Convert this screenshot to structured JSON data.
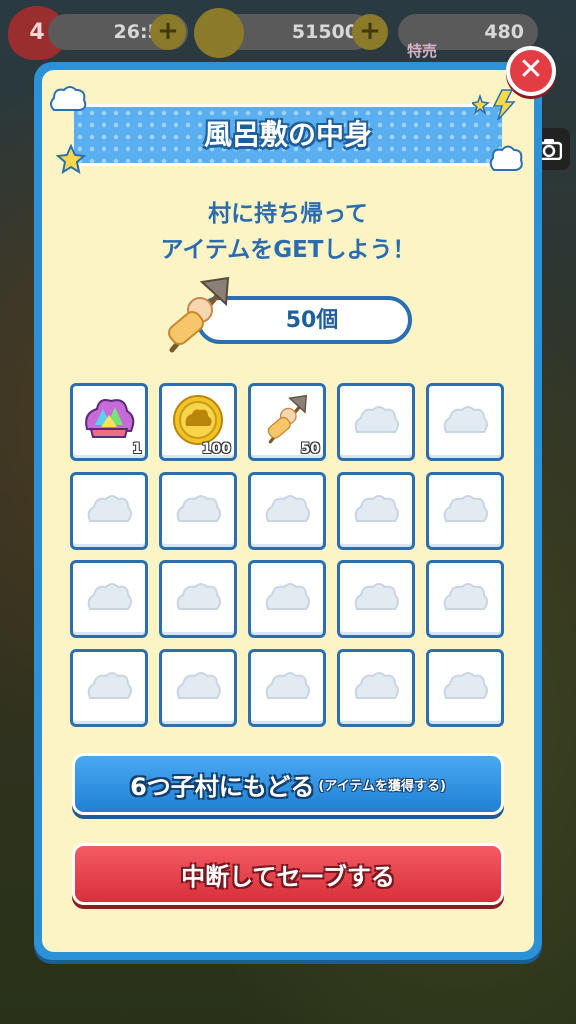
{
  "topbar": {
    "lives": "4",
    "timer": "26:59",
    "coins": "51500",
    "gems": "480",
    "sale_badge": "特売"
  },
  "dialog": {
    "title": "風呂敷の中身",
    "subtitle_line1": "村に持ち帰って",
    "subtitle_line2": "アイテムをGETしよう！",
    "item_count": "50個",
    "slots": [
      {
        "icon": "rainbow-crystal-icon",
        "qty": "1"
      },
      {
        "icon": "gold-coin-icon",
        "qty": "100"
      },
      {
        "icon": "oden-skewer-icon",
        "qty": "50"
      },
      {
        "icon": "empty-slot-icon",
        "qty": ""
      },
      {
        "icon": "empty-slot-icon",
        "qty": ""
      },
      {
        "icon": "empty-slot-icon",
        "qty": ""
      },
      {
        "icon": "empty-slot-icon",
        "qty": ""
      },
      {
        "icon": "empty-slot-icon",
        "qty": ""
      },
      {
        "icon": "empty-slot-icon",
        "qty": ""
      },
      {
        "icon": "empty-slot-icon",
        "qty": ""
      },
      {
        "icon": "empty-slot-icon",
        "qty": ""
      },
      {
        "icon": "empty-slot-icon",
        "qty": ""
      },
      {
        "icon": "empty-slot-icon",
        "qty": ""
      },
      {
        "icon": "empty-slot-icon",
        "qty": ""
      },
      {
        "icon": "empty-slot-icon",
        "qty": ""
      },
      {
        "icon": "empty-slot-icon",
        "qty": ""
      },
      {
        "icon": "empty-slot-icon",
        "qty": ""
      },
      {
        "icon": "empty-slot-icon",
        "qty": ""
      },
      {
        "icon": "empty-slot-icon",
        "qty": ""
      },
      {
        "icon": "empty-slot-icon",
        "qty": ""
      }
    ],
    "return_button_label": "6つ子村にもどる",
    "return_button_sub": "(アイテムを獲得する)",
    "save_button_label": "中断してセーブする"
  },
  "colors": {
    "frame_blue": "#2c91d6",
    "panel_cream": "#fdf4c6",
    "close_red": "#e23c45",
    "save_red": "#d8303b",
    "return_blue": "#1f7fd3"
  }
}
